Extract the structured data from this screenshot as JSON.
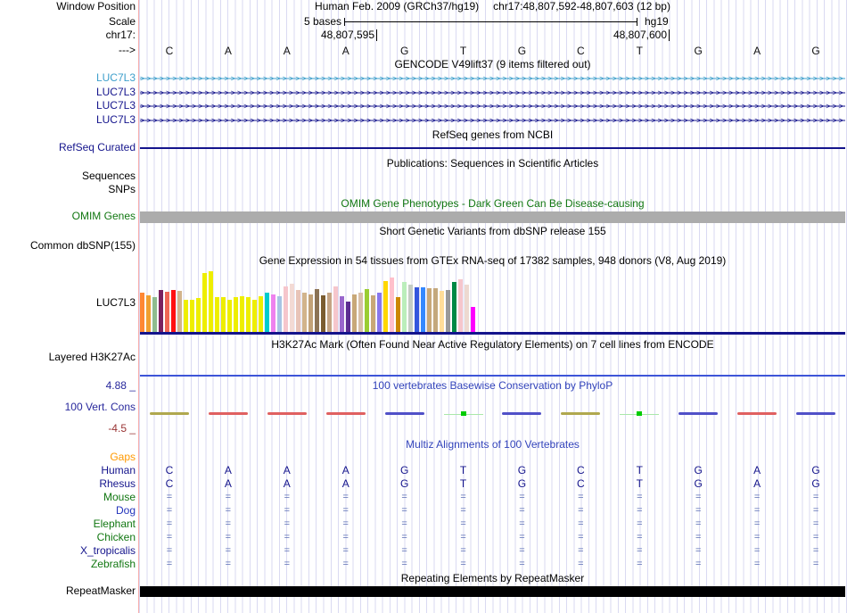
{
  "header": {
    "window_position_label": "Window Position",
    "assembly_line": "Human Feb. 2009 (GRCh37/hg19)",
    "position_line": "chr17:48,807,592-48,807,603 (12 bp)",
    "scale_label": "Scale",
    "scale_value": "5 bases",
    "assembly_short": "hg19",
    "chrom_label": "chr17:",
    "coord_left": "48,807,595",
    "coord_right": "48,807,600",
    "strand_marker": "--->",
    "bases": [
      "C",
      "A",
      "A",
      "A",
      "G",
      "T",
      "G",
      "C",
      "T",
      "G",
      "A",
      "G"
    ]
  },
  "tracks": {
    "gencode": {
      "title": "GENCODE V49lift37 (9 items filtered out)",
      "items": [
        {
          "label": "LUC7L3",
          "color": "#3e9fcb"
        },
        {
          "label": "LUC7L3",
          "color": "#14148c"
        },
        {
          "label": "LUC7L3",
          "color": "#14148c"
        },
        {
          "label": "LUC7L3",
          "color": "#14148c"
        }
      ]
    },
    "refseq": {
      "title": "RefSeq genes from NCBI",
      "label": "RefSeq Curated",
      "color": "#14148c"
    },
    "publications": {
      "title": "Publications: Sequences in Scientific Articles",
      "labels": [
        "Sequences",
        "SNPs"
      ]
    },
    "omim": {
      "title": "OMIM Gene Phenotypes - Dark Green Can Be Disease-causing",
      "label": "OMIM Genes",
      "title_color": "#117711",
      "bar_color": "#acacac"
    },
    "dbsnp": {
      "title": "Short Genetic Variants from dbSNP release 155",
      "label": "Common dbSNP(155)"
    },
    "gtex": {
      "title": "Gene Expression in 54 tissues from GTEx RNA-seq of 17382 samples, 948 donors (V8, Aug 2019)",
      "label": "LUC7L3"
    },
    "h3k27ac": {
      "title": "H3K27Ac Mark (Often Found Near Active Regulatory Elements) on 7 cell lines from ENCODE",
      "label": "Layered H3K27Ac",
      "line_color": "#3e55d8"
    },
    "conservation": {
      "title": "100 vertebrates Basewise Conservation by PhyloP",
      "label": "100 Vert. Cons",
      "max_label": "4.88 _",
      "min_label": "-4.5 _",
      "title_color": "#3344bb",
      "axis_color": "#28289c",
      "min_color": "#993333",
      "marks": [
        {
          "color": "#b0a84e",
          "type": "line"
        },
        {
          "color": "#e06060",
          "type": "line"
        },
        {
          "color": "#e06060",
          "type": "line"
        },
        {
          "color": "#e06060",
          "type": "line"
        },
        {
          "color": "#5050c8",
          "type": "line"
        },
        {
          "color": "#aae8aa",
          "type": "dot",
          "dot_color": "#00cc00"
        },
        {
          "color": "#5050c8",
          "type": "line"
        },
        {
          "color": "#b0a84e",
          "type": "line"
        },
        {
          "color": "#aae8aa",
          "type": "dot",
          "dot_color": "#00cc00"
        },
        {
          "color": "#5050c8",
          "type": "line"
        },
        {
          "color": "#e06060",
          "type": "line"
        },
        {
          "color": "#5050c8",
          "type": "line"
        }
      ]
    },
    "multiz": {
      "title": "Multiz Alignments of 100 Vertebrates",
      "title_color": "#3344bb",
      "gaps_label": "Gaps",
      "gaps_color": "#ff9900",
      "eq_color": "#5a6eb4",
      "base_color": "#14148c",
      "rows": [
        {
          "name": "Human",
          "label_color": "#14148c",
          "cells": [
            "C",
            "A",
            "A",
            "A",
            "G",
            "T",
            "G",
            "C",
            "T",
            "G",
            "A",
            "G"
          ]
        },
        {
          "name": "Rhesus",
          "label_color": "#14148c",
          "cells": [
            "C",
            "A",
            "A",
            "A",
            "G",
            "T",
            "G",
            "C",
            "T",
            "G",
            "A",
            "G"
          ]
        },
        {
          "name": "Mouse",
          "label_color": "#117711",
          "cells": [
            "=",
            "=",
            "=",
            "=",
            "=",
            "=",
            "=",
            "=",
            "=",
            "=",
            "=",
            "="
          ]
        },
        {
          "name": "Dog",
          "label_color": "#2233bb",
          "cells": [
            "=",
            "=",
            "=",
            "=",
            "=",
            "=",
            "=",
            "=",
            "=",
            "=",
            "=",
            "="
          ]
        },
        {
          "name": "Elephant",
          "label_color": "#117711",
          "cells": [
            "=",
            "=",
            "=",
            "=",
            "=",
            "=",
            "=",
            "=",
            "=",
            "=",
            "=",
            "="
          ]
        },
        {
          "name": "Chicken",
          "label_color": "#117711",
          "cells": [
            "=",
            "=",
            "=",
            "=",
            "=",
            "=",
            "=",
            "=",
            "=",
            "=",
            "=",
            "="
          ]
        },
        {
          "name": "X_tropicalis",
          "label_color": "#14148c",
          "cells": [
            "=",
            "=",
            "=",
            "=",
            "=",
            "=",
            "=",
            "=",
            "=",
            "=",
            "=",
            "="
          ]
        },
        {
          "name": "Zebrafish",
          "label_color": "#117711",
          "cells": [
            "=",
            "=",
            "=",
            "=",
            "=",
            "=",
            "=",
            "=",
            "=",
            "=",
            "=",
            "="
          ]
        }
      ]
    },
    "repeatmasker": {
      "title": "Repeating Elements by RepeatMasker",
      "label": "RepeatMasker",
      "bar_color": "#000000"
    }
  },
  "chart_data": {
    "type": "bar",
    "title": "Gene Expression in 54 tissues from GTEx RNA-seq of 17382 samples, 948 donors (V8, Aug 2019)",
    "gene": "LUC7L3",
    "n_bars": 54,
    "axis_labels_shown": false,
    "heights_pct": [
      62,
      58,
      56,
      67,
      64,
      67,
      65,
      51,
      51,
      54,
      93,
      96,
      56,
      56,
      51,
      56,
      57,
      56,
      51,
      57,
      62,
      60,
      57,
      72,
      76,
      67,
      62,
      60,
      68,
      58,
      62,
      72,
      57,
      49,
      60,
      62,
      68,
      58,
      62,
      81,
      86,
      56,
      79,
      75,
      71,
      71,
      69,
      69,
      65,
      67,
      79,
      83,
      75,
      40
    ],
    "colors": [
      "#FF8833",
      "#F0A030",
      "#8FBC8F",
      "#7A2160",
      "#EE6655",
      "#FF1111",
      "#D2B48C",
      "#EEEE00",
      "#EEEE00",
      "#EEEE00",
      "#EEEE00",
      "#EEEE00",
      "#EEEE00",
      "#EEEE00",
      "#EEEE00",
      "#EEEE00",
      "#EEEE00",
      "#EEEE00",
      "#EEEE00",
      "#EEEE00",
      "#00CCCC",
      "#EE82EE",
      "#A8C4E4",
      "#F6C6CC",
      "#F3DAD4",
      "#E8C4B8",
      "#D2B48C",
      "#C2A278",
      "#8B7355",
      "#7A5C30",
      "#C4A484",
      "#F6C6CC",
      "#9966CC",
      "#5C2D91",
      "#C8A878",
      "#D8C0A8",
      "#9ACD32",
      "#C8A878",
      "#8877EE",
      "#FFD700",
      "#FFC0CB",
      "#CC8800",
      "#BBEEBB",
      "#C4CCC4",
      "#3355DD",
      "#3388FF",
      "#C8A878",
      "#C4A87C",
      "#FFDD99",
      "#999999",
      "#008844",
      "#F6C6CC",
      "#EDD9D0",
      "#FF00FF"
    ]
  },
  "colors": {
    "grid": "#dadaf2",
    "edge_line": "#f7acac",
    "track_navy": "#14148c",
    "gtex_baseline": "#14148c"
  }
}
